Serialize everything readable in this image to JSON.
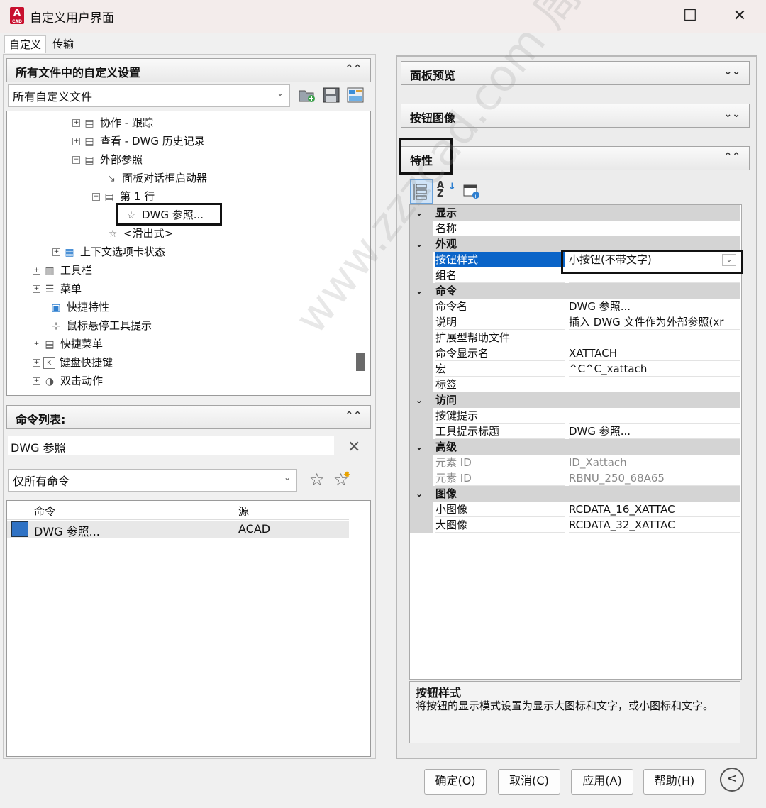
{
  "window": {
    "title": "自定义用户界面",
    "app_icon_letter": "A",
    "app_icon_sub": "CAD",
    "maximize_glyph": "☐",
    "close_glyph": "✕"
  },
  "tabs": [
    "自定义",
    "传输"
  ],
  "left_top": {
    "header": "所有文件中的自定义设置",
    "file_combo": "所有自定义文件",
    "tree": [
      {
        "label": "协作 - 跟踪",
        "expander": "+"
      },
      {
        "label": "查看 - DWG 历史记录",
        "expander": "+"
      },
      {
        "label": "外部参照",
        "expander": "−"
      },
      {
        "label": "面板对话框启动器",
        "expander": ""
      },
      {
        "label": "第 1 行",
        "expander": "−"
      },
      {
        "label": "DWG 参照...",
        "expander": ""
      },
      {
        "label": "<滑出式>",
        "expander": ""
      },
      {
        "label": "上下文选项卡状态",
        "expander": "+"
      },
      {
        "label": "工具栏",
        "expander": "+"
      },
      {
        "label": "菜单",
        "expander": "+"
      },
      {
        "label": "快捷特性",
        "expander": ""
      },
      {
        "label": "鼠标悬停工具提示",
        "expander": ""
      },
      {
        "label": "快捷菜单",
        "expander": "+"
      },
      {
        "label": "键盘快捷键",
        "expander": "+"
      },
      {
        "label": "双击动作",
        "expander": "+"
      }
    ]
  },
  "command_list": {
    "header": "命令列表:",
    "search_value": "DWG 参照",
    "filter_combo": "仅所有命令",
    "columns": [
      "命令",
      "源"
    ],
    "rows": [
      {
        "command": "DWG 参照...",
        "source": "ACAD"
      }
    ]
  },
  "right": {
    "panel_preview": "面板预览",
    "button_image": "按钮图像",
    "properties": "特性",
    "grid": [
      {
        "type": "section",
        "label": "显示"
      },
      {
        "type": "row",
        "name": "名称",
        "value": ""
      },
      {
        "type": "section",
        "label": "外观"
      },
      {
        "type": "row",
        "name": "按钮样式",
        "value": "小按钮(不带文字)",
        "selected": true
      },
      {
        "type": "row",
        "name": "组名",
        "value": ""
      },
      {
        "type": "section",
        "label": "命令"
      },
      {
        "type": "row",
        "name": "命令名",
        "value": "DWG 参照..."
      },
      {
        "type": "row",
        "name": "说明",
        "value": "插入 DWG 文件作为外部参照(xr"
      },
      {
        "type": "row",
        "name": "扩展型帮助文件",
        "value": ""
      },
      {
        "type": "row",
        "name": "命令显示名",
        "value": "XATTACH"
      },
      {
        "type": "row",
        "name": "宏",
        "value": "^C^C_xattach"
      },
      {
        "type": "row",
        "name": "标签",
        "value": ""
      },
      {
        "type": "section",
        "label": "访问"
      },
      {
        "type": "row",
        "name": "按键提示",
        "value": ""
      },
      {
        "type": "row",
        "name": "工具提示标题",
        "value": "DWG 参照..."
      },
      {
        "type": "section",
        "label": "高级"
      },
      {
        "type": "row",
        "name": "元素 ID",
        "value": "ID_Xattach",
        "disabled": true
      },
      {
        "type": "row",
        "name": "元素 ID",
        "value": "RBNU_250_68A65",
        "disabled": true
      },
      {
        "type": "section",
        "label": "图像"
      },
      {
        "type": "row",
        "name": "小图像",
        "value": "RCDATA_16_XATTAC"
      },
      {
        "type": "row",
        "name": "大图像",
        "value": "RCDATA_32_XATTAC"
      }
    ],
    "description_title": "按钮样式",
    "description_text": "将按钮的显示模式设置为显示大图标和文字，或小图标和文字。"
  },
  "buttons": {
    "ok": "确定(O)",
    "cancel": "取消(C)",
    "apply": "应用(A)",
    "help": "帮助(H)"
  },
  "watermark": "www.zzzcad.com 周站长CAD"
}
